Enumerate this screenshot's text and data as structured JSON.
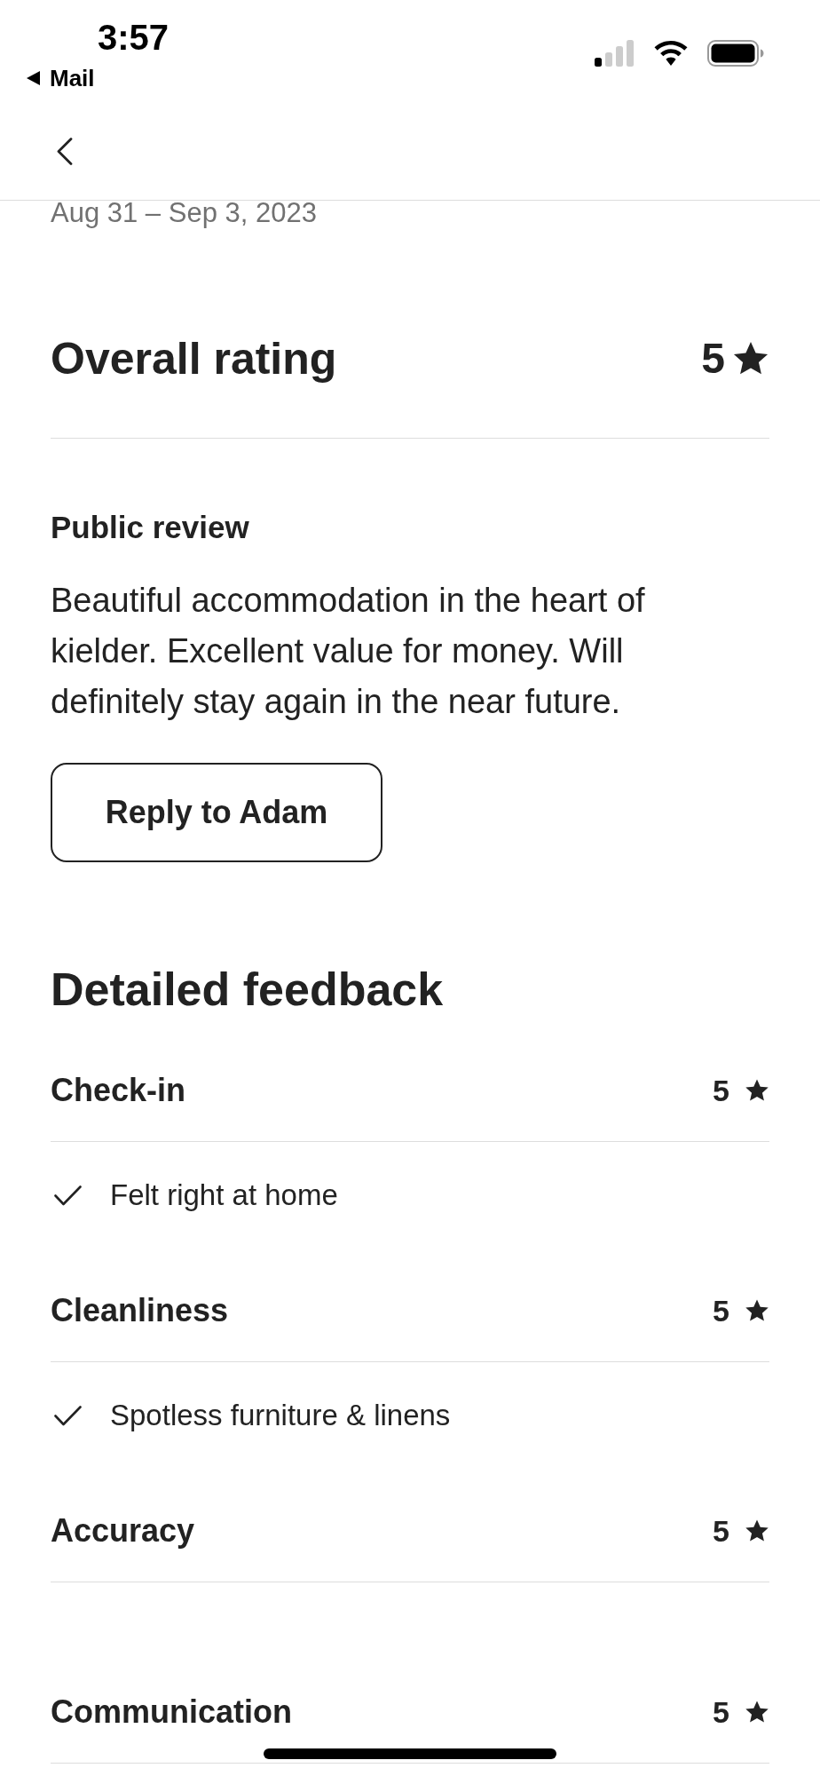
{
  "status_bar": {
    "time": "3:57",
    "back_label": "Mail"
  },
  "stay_dates": "Aug 31 – Sep 3, 2023",
  "overall": {
    "title": "Overall rating",
    "rating": "5"
  },
  "public_review": {
    "heading": "Public review",
    "text": "Beautiful accommodation in the heart of kielder. Excellent value for money. Will definitely stay again in the near future.",
    "reply_button": "Reply to Adam"
  },
  "detailed_feedback": {
    "title": "Detailed feedback",
    "categories": [
      {
        "name": "Check-in",
        "rating": "5",
        "highlights": [
          "Felt right at home"
        ]
      },
      {
        "name": "Cleanliness",
        "rating": "5",
        "highlights": [
          "Spotless furniture & linens"
        ]
      },
      {
        "name": "Accuracy",
        "rating": "5"
      },
      {
        "name": "Communication",
        "rating": "5"
      }
    ]
  }
}
